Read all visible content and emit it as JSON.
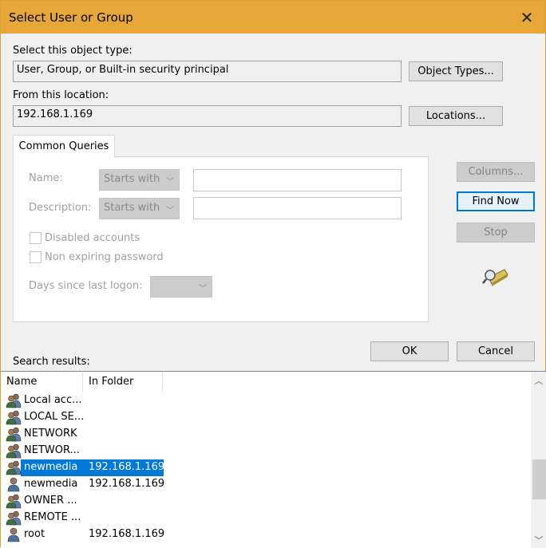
{
  "window": {
    "title": "Select User or Group",
    "close_glyph": "✕"
  },
  "object_type": {
    "label": "Select this object type:",
    "value": "User, Group, or Built-in security principal",
    "button": "Object Types..."
  },
  "location": {
    "label": "From this location:",
    "value": "192.168.1.169",
    "button": "Locations..."
  },
  "tabs": [
    {
      "label": "Common Queries"
    }
  ],
  "queries": {
    "name_label": "Name:",
    "name_combo": "Starts with",
    "description_label": "Description:",
    "description_combo": "Starts with",
    "disabled_accounts": "Disabled accounts",
    "non_expiring": "Non expiring password",
    "days_label": "Days since last logon:"
  },
  "side_buttons": {
    "columns": "Columns...",
    "find_now": "Find Now",
    "stop": "Stop"
  },
  "dialog_buttons": {
    "ok": "OK",
    "cancel": "Cancel"
  },
  "results": {
    "label": "Search results:",
    "columns": [
      "Name",
      "In Folder"
    ],
    "rows": [
      {
        "name": "Local acc...",
        "folder": "",
        "icon": "group-icon"
      },
      {
        "name": "LOCAL SE...",
        "folder": "",
        "icon": "group-icon"
      },
      {
        "name": "NETWORK",
        "folder": "",
        "icon": "group-icon"
      },
      {
        "name": "NETWOR...",
        "folder": "",
        "icon": "group-icon"
      },
      {
        "name": "newmedia",
        "folder": "192.168.1.169",
        "icon": "group-icon",
        "selected": true
      },
      {
        "name": "newmedia",
        "folder": "192.168.1.169",
        "icon": "user-icon"
      },
      {
        "name": "OWNER ...",
        "folder": "",
        "icon": "group-icon"
      },
      {
        "name": "REMOTE ...",
        "folder": "",
        "icon": "group-icon"
      },
      {
        "name": "root",
        "folder": "192.168.1.169",
        "icon": "user-icon"
      }
    ]
  },
  "colors": {
    "titlebar": "#e6a638",
    "selection": "#0078d7"
  }
}
